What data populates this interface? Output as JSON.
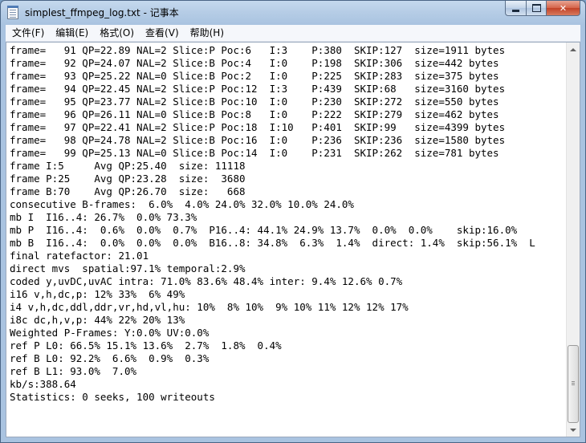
{
  "window": {
    "title": "simplest_ffmpeg_log.txt - 记事本",
    "controls": {
      "minimize": "",
      "maximize": "",
      "close": "✕"
    }
  },
  "menu": [
    {
      "label": "文件(F)"
    },
    {
      "label": "编辑(E)"
    },
    {
      "label": "格式(O)"
    },
    {
      "label": "查看(V)"
    },
    {
      "label": "帮助(H)"
    }
  ],
  "editor": {
    "text": "frame=   91 QP=22.89 NAL=2 Slice:P Poc:6   I:3    P:380  SKIP:127  size=1911 bytes\nframe=   92 QP=24.07 NAL=2 Slice:B Poc:4   I:0    P:198  SKIP:306  size=442 bytes\nframe=   93 QP=25.22 NAL=0 Slice:B Poc:2   I:0    P:225  SKIP:283  size=375 bytes\nframe=   94 QP=22.45 NAL=2 Slice:P Poc:12  I:3    P:439  SKIP:68   size=3160 bytes\nframe=   95 QP=23.77 NAL=2 Slice:B Poc:10  I:0    P:230  SKIP:272  size=550 bytes\nframe=   96 QP=26.11 NAL=0 Slice:B Poc:8   I:0    P:222  SKIP:279  size=462 bytes\nframe=   97 QP=22.41 NAL=2 Slice:P Poc:18  I:10   P:401  SKIP:99   size=4399 bytes\nframe=   98 QP=24.78 NAL=2 Slice:B Poc:16  I:0    P:236  SKIP:236  size=1580 bytes\nframe=   99 QP=25.13 NAL=0 Slice:B Poc:14  I:0    P:231  SKIP:262  size=781 bytes\nframe I:5     Avg QP:25.40  size: 11118\nframe P:25    Avg QP:23.28  size:  3680\nframe B:70    Avg QP:26.70  size:   668\nconsecutive B-frames:  6.0%  4.0% 24.0% 32.0% 10.0% 24.0%\nmb I  I16..4: 26.7%  0.0% 73.3%\nmb P  I16..4:  0.6%  0.0%  0.7%  P16..4: 44.1% 24.9% 13.7%  0.0%  0.0%    skip:16.0%\nmb B  I16..4:  0.0%  0.0%  0.0%  B16..8: 34.8%  6.3%  1.4%  direct: 1.4%  skip:56.1%  L\nfinal ratefactor: 21.01\ndirect mvs  spatial:97.1% temporal:2.9%\ncoded y,uvDC,uvAC intra: 71.0% 83.6% 48.4% inter: 9.4% 12.6% 0.7%\ni16 v,h,dc,p: 12% 33%  6% 49%\ni4 v,h,dc,ddl,ddr,vr,hd,vl,hu: 10%  8% 10%  9% 10% 11% 12% 12% 17%\ni8c dc,h,v,p: 44% 22% 20% 13%\nWeighted P-Frames: Y:0.0% UV:0.0%\nref P L0: 66.5% 15.1% 13.6%  2.7%  1.8%  0.4%\nref B L0: 92.2%  6.6%  0.9%  0.3%\nref B L1: 93.0%  7.0%\nkb/s:388.64\nStatistics: 0 seeks, 100 writeouts"
  }
}
